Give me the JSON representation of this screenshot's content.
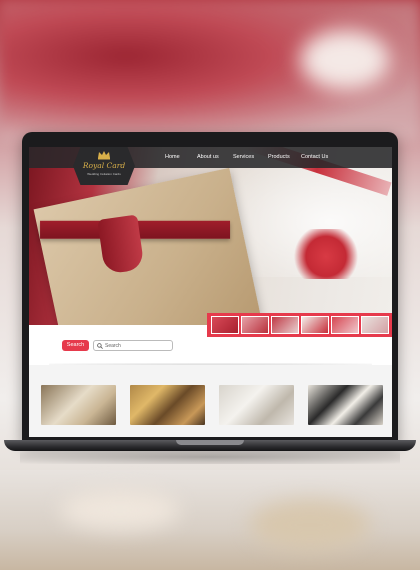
{
  "site": {
    "logo": {
      "name": "Royal Card",
      "tagline": "Wedding Invitation Cards",
      "icon": "crown-icon"
    },
    "nav": [
      {
        "label": "Home"
      },
      {
        "label": "About us"
      },
      {
        "label": "Services"
      },
      {
        "label": "Products"
      },
      {
        "label": "Contact Us"
      }
    ]
  },
  "hero": {
    "thumbnails": [
      {
        "name": "thumb-1"
      },
      {
        "name": "thumb-2"
      },
      {
        "name": "thumb-3"
      },
      {
        "name": "thumb-4"
      },
      {
        "name": "thumb-5"
      },
      {
        "name": "thumb-6"
      }
    ]
  },
  "search": {
    "button_label": "Search",
    "placeholder": "Search",
    "icon": "search-icon"
  },
  "colors": {
    "accent": "#e63a4c",
    "nav_bg": "#28282a",
    "logo_gold": "#d9b04a"
  }
}
